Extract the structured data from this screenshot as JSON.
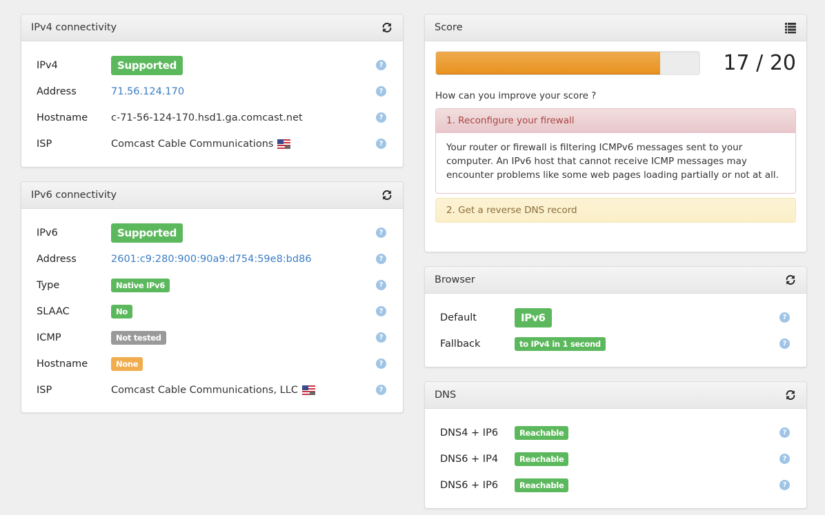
{
  "ipv4": {
    "title": "IPv4 connectivity",
    "header_icon": "refresh-icon",
    "rows": [
      {
        "label": "IPv4",
        "value": "Supported",
        "kind": "badge",
        "color": "#5cb85c"
      },
      {
        "label": "Address",
        "value": "71.56.124.170",
        "kind": "link"
      },
      {
        "label": "Hostname",
        "value": "c-71-56-124-170.hsd1.ga.comcast.net",
        "kind": "text"
      },
      {
        "label": "ISP",
        "value": "Comcast Cable Communications",
        "kind": "text",
        "flag": "us-flag-icon"
      }
    ],
    "help_icon": "question-icon"
  },
  "ipv6": {
    "title": "IPv6 connectivity",
    "header_icon": "refresh-icon",
    "rows": [
      {
        "label": "IPv6",
        "value": "Supported",
        "kind": "badge",
        "color": "#5cb85c"
      },
      {
        "label": "Address",
        "value": "2601:c9:280:900:90a9:d754:59e8:bd86",
        "kind": "link"
      },
      {
        "label": "Type",
        "value": "Native IPv6",
        "kind": "badge-sm",
        "color": "#5cb85c"
      },
      {
        "label": "SLAAC",
        "value": "No",
        "kind": "badge-sm",
        "color": "#5cb85c"
      },
      {
        "label": "ICMP",
        "value": "Not tested",
        "kind": "badge-sm",
        "color": "#999999"
      },
      {
        "label": "Hostname",
        "value": "None",
        "kind": "badge-sm",
        "color": "#f0ad4e"
      },
      {
        "label": "ISP",
        "value": "Comcast Cable Communications, LLC",
        "kind": "text",
        "flag": "us-flag-icon"
      }
    ]
  },
  "score": {
    "title": "Score",
    "header_icon": "list-icon",
    "value_text": "17 / 20",
    "progress_fraction": 0.85,
    "bar_color": "#e8921f",
    "improve_question": "How can you improve your score ?",
    "advice": [
      {
        "title": "1. Reconfigure your firewall",
        "body": "Your router or firewall is filtering ICMPv6 messages sent to your computer. An IPv6 host that cannot receive ICMP messages may encounter problems like some web pages loading partially or not at all.",
        "level": "danger"
      },
      {
        "title": "2. Get a reverse DNS record",
        "level": "warning"
      }
    ]
  },
  "browser": {
    "title": "Browser",
    "header_icon": "refresh-icon",
    "rows": [
      {
        "label": "Default",
        "value": "IPv6",
        "kind": "badge",
        "color": "#5cb85c"
      },
      {
        "label": "Fallback",
        "value": "to IPv4 in 1 second",
        "kind": "badge-sm",
        "color": "#5cb85c"
      }
    ]
  },
  "dns": {
    "title": "DNS",
    "header_icon": "refresh-icon",
    "rows": [
      {
        "label": "DNS4 + IP6",
        "value": "Reachable",
        "kind": "badge-sm",
        "color": "#5cb85c"
      },
      {
        "label": "DNS6 + IP4",
        "value": "Reachable",
        "kind": "badge-sm",
        "color": "#5cb85c"
      },
      {
        "label": "DNS6 + IP6",
        "value": "Reachable",
        "kind": "badge-sm",
        "color": "#5cb85c"
      }
    ]
  },
  "colors": {
    "link": "#3a7cc4",
    "help_icon": "#9fc4e6",
    "background": "#efefef"
  }
}
